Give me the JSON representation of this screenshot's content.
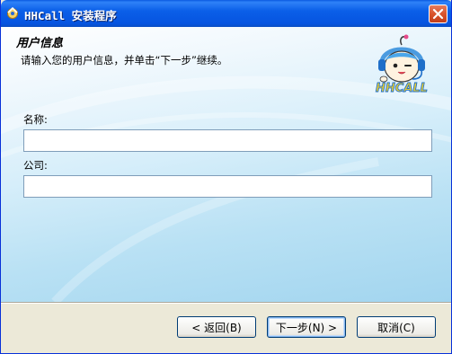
{
  "window": {
    "title": "HHCall 安装程序"
  },
  "header": {
    "title": "用户信息",
    "description": "请输入您的用户信息，并单击“下一步”继续。",
    "logo_text": "HHCALL"
  },
  "form": {
    "name_label": "名称:",
    "name_value": "",
    "company_label": "公司:",
    "company_value": ""
  },
  "buttons": {
    "back_label": "< 返回(B)",
    "next_label": "下一步(N) >",
    "cancel_label": "取消(C)"
  }
}
